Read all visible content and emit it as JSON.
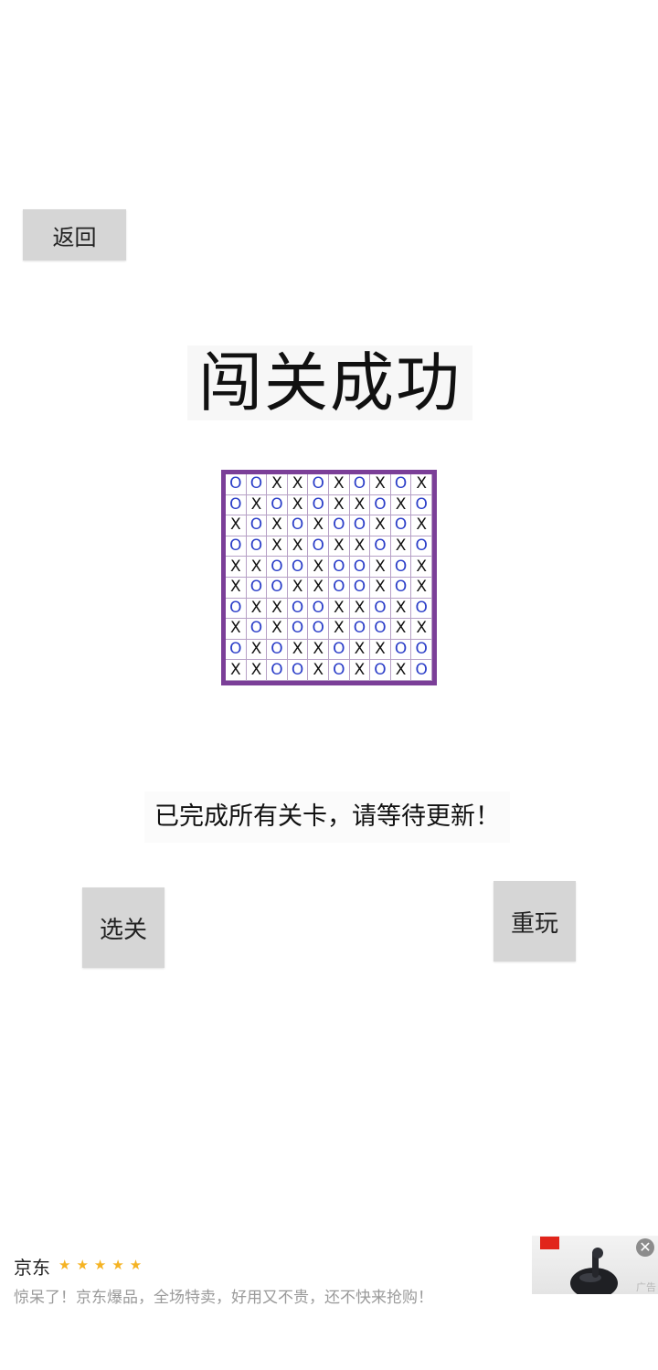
{
  "back_button": {
    "label": "返回"
  },
  "title": "闯关成功",
  "board": {
    "rows": [
      [
        "O",
        "O",
        "X",
        "X",
        "O",
        "X",
        "O",
        "X",
        "O",
        "X"
      ],
      [
        "O",
        "X",
        "O",
        "X",
        "O",
        "X",
        "X",
        "O",
        "X",
        "O"
      ],
      [
        "X",
        "O",
        "X",
        "O",
        "X",
        "O",
        "O",
        "X",
        "O",
        "X"
      ],
      [
        "O",
        "O",
        "X",
        "X",
        "O",
        "X",
        "X",
        "O",
        "X",
        "O"
      ],
      [
        "X",
        "X",
        "O",
        "O",
        "X",
        "O",
        "O",
        "X",
        "O",
        "X"
      ],
      [
        "X",
        "O",
        "O",
        "X",
        "X",
        "O",
        "O",
        "X",
        "O",
        "X"
      ],
      [
        "O",
        "X",
        "X",
        "O",
        "O",
        "X",
        "X",
        "O",
        "X",
        "O"
      ],
      [
        "X",
        "O",
        "X",
        "O",
        "O",
        "X",
        "O",
        "O",
        "X",
        "X"
      ],
      [
        "O",
        "X",
        "O",
        "X",
        "X",
        "O",
        "X",
        "X",
        "O",
        "O"
      ],
      [
        "X",
        "X",
        "O",
        "O",
        "X",
        "O",
        "X",
        "O",
        "X",
        "O"
      ]
    ],
    "colors": {
      "border": "#7b3f98",
      "o": "#2a3dc8",
      "x": "#111111"
    }
  },
  "message": "已完成所有关卡，请等待更新！",
  "buttons": {
    "select_label": "选关",
    "replay_label": "重玩"
  },
  "ad": {
    "title": "京东",
    "stars": "★★★★★",
    "description": "惊呆了！京东爆品，全场特卖，好用又不贵，还不快来抢购！",
    "close_glyph": "✕",
    "mark": "广告"
  }
}
